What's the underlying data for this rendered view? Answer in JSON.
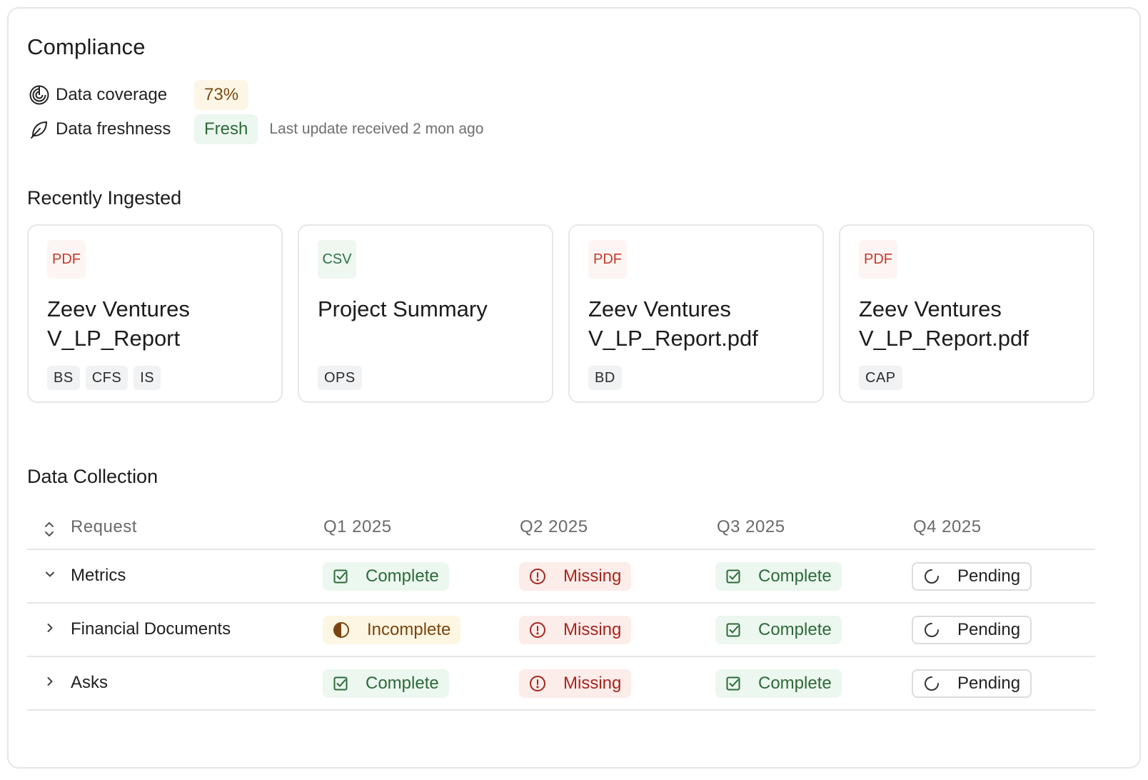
{
  "title": "Compliance",
  "metrics": {
    "coverage": {
      "label": "Data coverage",
      "value": "73%",
      "icon": "gauge-icon"
    },
    "freshness": {
      "label": "Data freshness",
      "value": "Fresh",
      "note": "Last update received 2 mon ago",
      "icon": "leaf-icon"
    }
  },
  "recently_ingested": {
    "title": "Recently Ingested",
    "cards": [
      {
        "type": "PDF",
        "name": "Zeev Ventures V_LP_Report",
        "tags": [
          "BS",
          "CFS",
          "IS"
        ]
      },
      {
        "type": "CSV",
        "name": "Project Summary",
        "tags": [
          "OPS"
        ]
      },
      {
        "type": "PDF",
        "name": "Zeev Ventures V_LP_Report.pdf",
        "tags": [
          "BD"
        ]
      },
      {
        "type": "PDF",
        "name": "Zeev Ventures V_LP_Report.pdf",
        "tags": [
          "CAP"
        ]
      }
    ]
  },
  "data_collection": {
    "title": "Data Collection",
    "columns": [
      "Request",
      "Q1 2025",
      "Q2 2025",
      "Q3 2025",
      "Q4 2025"
    ],
    "rows": [
      {
        "label": "Metrics",
        "expanded": true,
        "statuses": [
          "Complete",
          "Missing",
          "Complete",
          "Pending"
        ]
      },
      {
        "label": "Financial Documents",
        "expanded": false,
        "statuses": [
          "Incomplete",
          "Missing",
          "Complete",
          "Pending"
        ]
      },
      {
        "label": "Asks",
        "expanded": false,
        "statuses": [
          "Complete",
          "Missing",
          "Complete",
          "Pending"
        ]
      }
    ]
  },
  "colors": {
    "complete": "#2d6a3a",
    "missing": "#a6271c",
    "incomplete": "#7a4410",
    "pdf": "#c53a2b",
    "csv": "#2e7040"
  }
}
